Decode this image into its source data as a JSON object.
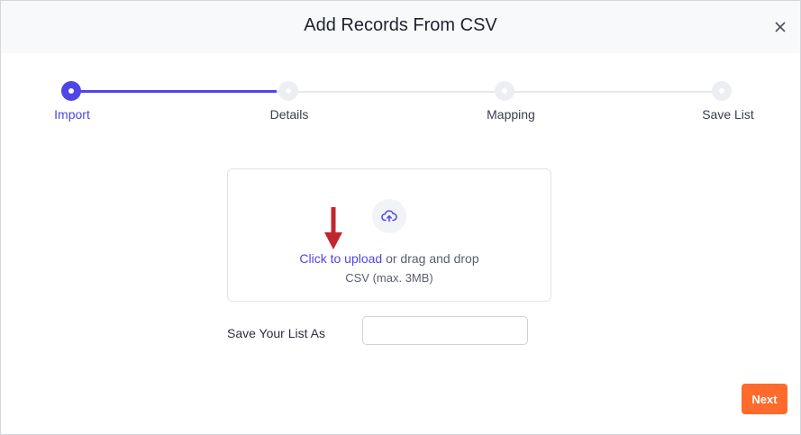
{
  "modal": {
    "title": "Add Records From CSV",
    "close_icon": "close-icon"
  },
  "stepper": {
    "steps": [
      {
        "label": "Import",
        "state": "active"
      },
      {
        "label": "Details",
        "state": "inactive"
      },
      {
        "label": "Mapping",
        "state": "inactive"
      },
      {
        "label": "Save List",
        "state": "inactive"
      }
    ]
  },
  "upload": {
    "icon": "cloud-upload-icon",
    "link_text": "Click to upload",
    "rest_text": " or drag and drop",
    "hint": "CSV (max. 3MB)"
  },
  "save_list": {
    "label": "Save Your List As",
    "value": "",
    "placeholder": ""
  },
  "footer": {
    "next_label": "Next"
  },
  "colors": {
    "accent": "#4f46e5",
    "next_button": "#ff6b2c",
    "annotation_arrow": "#c0272d"
  }
}
